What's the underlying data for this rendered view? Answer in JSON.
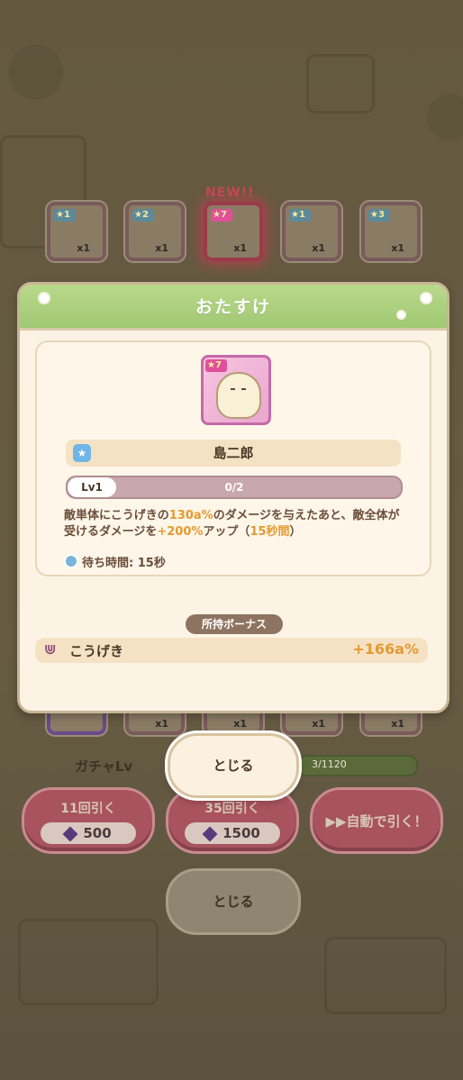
{
  "background": {
    "tiles": [
      {
        "stars": "1",
        "qty": "x1"
      },
      {
        "stars": "2",
        "qty": "x1"
      },
      {
        "stars": "7",
        "qty": "x1"
      },
      {
        "stars": "1",
        "qty": "x1"
      },
      {
        "stars": "3",
        "qty": "x1"
      }
    ],
    "new_label": "NEW!!",
    "bottom_tiles_qty": [
      "x1",
      "x1",
      "x1",
      "x1"
    ],
    "gacha_lv_label": "ガチャLv",
    "gacha_lv_progress": "3/1120",
    "draw_11_label": "11回引く",
    "draw_11_cost": "500",
    "draw_35_label": "35回引く",
    "draw_35_cost": "1500",
    "auto_draw_label": "▶▶自動で引く！",
    "bg_close_label": "とじる"
  },
  "dialog": {
    "title": "おたすけ",
    "helper": {
      "stars": "7",
      "name": "島二郎",
      "level": "Lv1",
      "progress": "0/2",
      "description_parts": {
        "p1": "敵単体にこうげきの",
        "v1": "130a%",
        "p2": "のダメージを与えたあと、敵全体が受けるダメージを",
        "v2": "+200%",
        "p3": "アップ（",
        "v3": "15秒間",
        "p4": "）"
      },
      "wait_time": "待ち時間: 15秒"
    },
    "bonus_tag": "所持ボーナス",
    "bonus": {
      "label": "こうげき",
      "value": "+166a%"
    }
  },
  "close_button_label": "とじる",
  "colors": {
    "header_green": "#a0c874",
    "highlight_orange": "#e49a30",
    "dialog_bg": "#fbf4e4"
  }
}
